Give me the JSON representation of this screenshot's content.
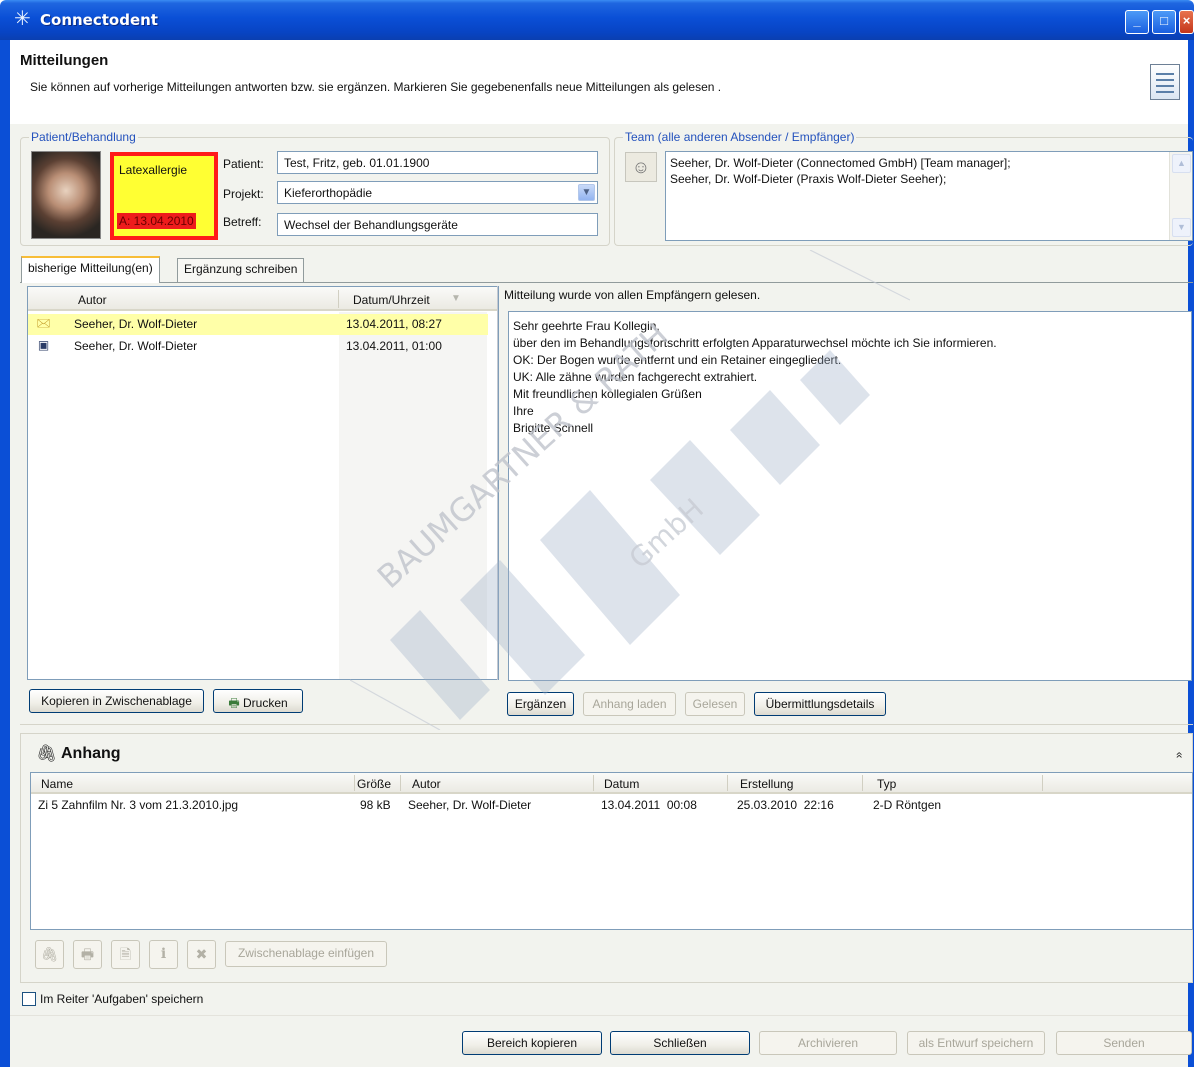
{
  "window": {
    "title": "Connectodent",
    "controls": {
      "minimize": "_",
      "maximize": "□",
      "close": "×"
    }
  },
  "header": {
    "title": "Mitteilungen",
    "description": "Sie können auf vorherige Mitteilungen antworten bzw. sie ergänzen. Markieren Sie gegebenenfalls neue Mitteilungen als gelesen ."
  },
  "patient": {
    "group_label": "Patient/Behandlung",
    "allergy": "Latexallergie",
    "allergy_date": "A: 13.04.2010",
    "patient_label": "Patient:",
    "patient_value": "Test, Fritz, geb. 01.01.1900",
    "project_label": "Projekt:",
    "project_value": "Kieferorthopädie",
    "subject_label": "Betreff:",
    "subject_value": "Wechsel der Behandlungsgeräte"
  },
  "team": {
    "group_label": "Team (alle anderen Absender / Empfänger)",
    "members": [
      "Seeher, Dr. Wolf-Dieter (Connectomed GmbH) [Team manager];",
      "Seeher, Dr. Wolf-Dieter (Praxis Wolf-Dieter Seeher);"
    ]
  },
  "tabs": [
    {
      "label": "bisherige Mitteilung(en)",
      "active": true
    },
    {
      "label": "Ergänzung schreiben",
      "active": false
    }
  ],
  "messages": {
    "columns": [
      "Autor",
      "Datum/Uhrzeit"
    ],
    "rows": [
      {
        "author": "Seeher, Dr. Wolf-Dieter",
        "datetime": "13.04.2011, 08:27",
        "icon": "mail-new-icon",
        "highlighted": true
      },
      {
        "author": "Seeher, Dr. Wolf-Dieter",
        "datetime": "13.04.2011, 01:00",
        "icon": "mail-read-icon",
        "highlighted": false
      }
    ],
    "copy_button": "Kopieren in Zwischenablage",
    "print_button": "Drucken"
  },
  "message_view": {
    "status": "Mitteilung wurde von allen Empfängern gelesen.",
    "body": [
      "Sehr geehrte Frau Kollegin,",
      "",
      "über den im Behandlungsfortschritt erfolgten Apparaturwechsel möchte ich Sie informieren.",
      "",
      "OK: Der Bogen wurde entfernt und ein Retainer eingegliedert.",
      "UK: Alle zähne wurden fachgerecht extrahiert.",
      "",
      "Mit freundlichen kollegialen Grüßen",
      "Ihre",
      "Brigitte Schnell"
    ],
    "buttons": {
      "supplement": "Ergänzen",
      "load_attachment": "Anhang laden",
      "read": "Gelesen",
      "transmission_details": "Übermittlungsdetails"
    }
  },
  "attachments": {
    "title": "Anhang",
    "collapse": "»",
    "columns": [
      "Name",
      "Größe",
      "Autor",
      "Datum",
      "Erstellung",
      "Typ"
    ],
    "rows": [
      {
        "name": "Zi 5 Zahnfilm Nr. 3 vom 21.3.2010.jpg",
        "size": "98 kB",
        "author": "Seeher, Dr. Wolf-Dieter",
        "date": "13.04.2011  00:08",
        "created": "25.03.2010  22:16",
        "type": "2-D Röntgen"
      }
    ],
    "toolbar": {
      "paste": "Zwischenablage einfügen",
      "info": "i"
    }
  },
  "footer": {
    "save_in_tasks": "Im Reiter 'Aufgaben' speichern",
    "buttons": {
      "copy_area": "Bereich kopieren",
      "close": "Schließen",
      "archive": "Archivieren",
      "save_draft": "als Entwurf speichern",
      "send": "Senden"
    }
  },
  "watermark": {
    "line1": "BAUMGARTNER & RATH",
    "line2": "GmbH"
  },
  "colors": {
    "title_blue": "#0a4fd6",
    "allergy_yellow": "#ffff33",
    "allergy_red": "#ff1a1a",
    "highlight_row": "#ffffa8",
    "group_legend": "#2452bd"
  }
}
